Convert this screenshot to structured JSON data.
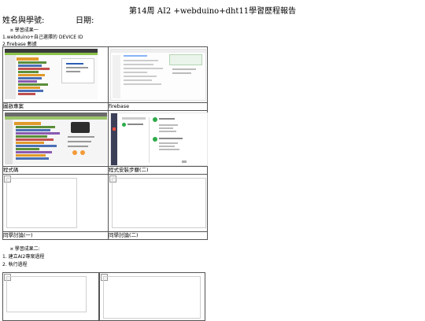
{
  "doc": {
    "title": "第14周 AI2 +webduino+dht11學習歷程報告",
    "name_label": "姓名與學號:",
    "date_label": "日期:",
    "section1_heading": "學習成果一",
    "item1": "1.webduino+自己選擇的 DEVICE ID",
    "item2": "2.firebase 數據",
    "captions": [
      "圖啟專案",
      "firebase",
      "程式碼",
      "程式安裝步驟(二)",
      "同學討論(一)",
      "同學討論(二)"
    ],
    "section2_heading": "學習成果二:",
    "step1": "1. 建立AI2專案過程",
    "step2": "2. 執行過程",
    "bullet_glyph": "¤"
  }
}
